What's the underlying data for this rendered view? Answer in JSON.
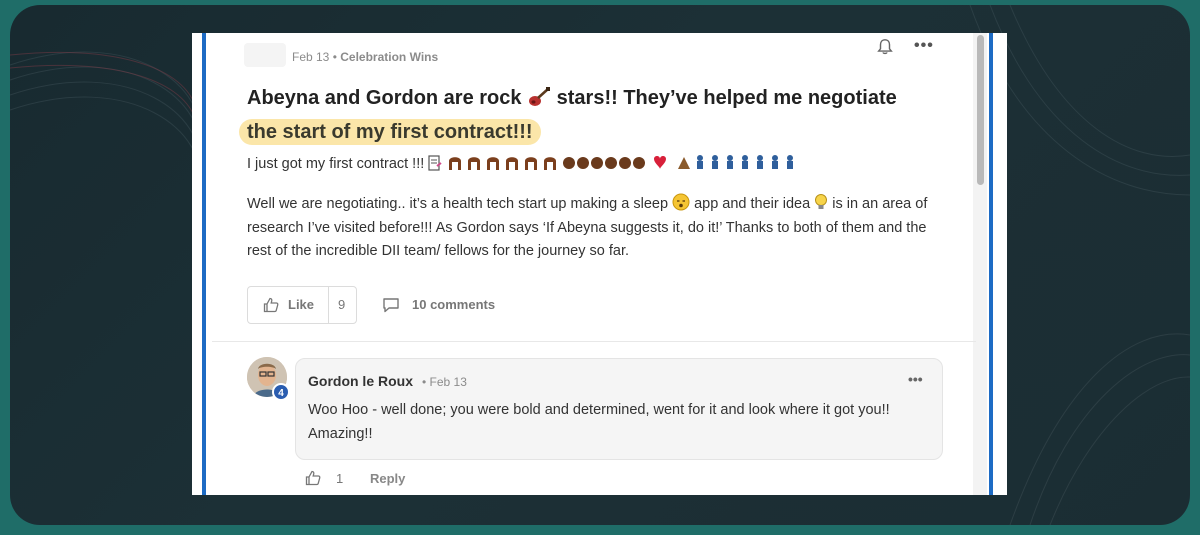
{
  "post": {
    "date": "Feb 13",
    "separator": "•",
    "category": "Celebration Wins",
    "title_part1": "Abeyna and Gordon are rock ",
    "title_part2": " stars!! They’ve helped me negotiate",
    "title_highlight": "the start of my first contract!!!",
    "line1": "I just got my first contract !!!",
    "body_part1": "Well we are negotiating.. it’s a health tech start up making a sleep ",
    "body_part2": " app and their idea ",
    "body_part3": " is in an area of research I’ve visited before!!! As Gordon says ‘If Abeyna suggests it, do it!’ Thanks to both of them and the rest of the incredible DII team/ fellows for the journey so far."
  },
  "actions": {
    "like_label": "Like",
    "like_count": "9",
    "comments_label": "10 comments"
  },
  "comment": {
    "author": "Gordon le Roux",
    "date": "• Feb 13",
    "badge": "4",
    "text": "Woo Hoo - well done; you were bold and determined, went for it and look where it got you!! Amazing!!",
    "like_count": "1",
    "reply_label": "Reply"
  },
  "icons": {
    "bell": "bell-icon",
    "more": "more-options-icon",
    "like": "thumbs-up-icon",
    "comment": "comment-icon"
  },
  "colors": {
    "highlight": "#fbe6a9",
    "accent_edge": "#1d6bc4",
    "badge": "#2a5db0"
  }
}
